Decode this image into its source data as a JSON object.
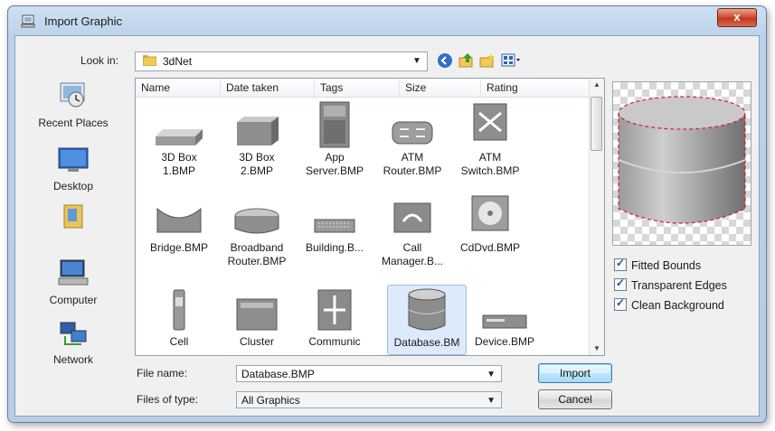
{
  "window": {
    "title": "Import Graphic",
    "close_glyph": "x"
  },
  "lookin": {
    "label": "Look in:",
    "value": "3dNet"
  },
  "places": [
    {
      "label": "Recent Places",
      "icon": "recent-places-icon"
    },
    {
      "label": "Desktop",
      "icon": "desktop-icon"
    },
    {
      "label": "",
      "icon": "user-folder-icon"
    },
    {
      "label": "Computer",
      "icon": "computer-icon"
    },
    {
      "label": "Network",
      "icon": "network-icon"
    }
  ],
  "columns": [
    "Name",
    "Date taken",
    "Tags",
    "Size",
    "Rating"
  ],
  "files": [
    {
      "line1": "3D Box",
      "line2": "1.BMP"
    },
    {
      "line1": "3D Box",
      "line2": "2.BMP"
    },
    {
      "line1": "App",
      "line2": "Server.BMP"
    },
    {
      "line1": "ATM",
      "line2": "Router.BMP"
    },
    {
      "line1": "ATM",
      "line2": "Switch.BMP"
    },
    {
      "line1": "Bridge.BMP",
      "line2": ""
    },
    {
      "line1": "Broadband",
      "line2": "Router.BMP"
    },
    {
      "line1": "Building.B...",
      "line2": ""
    },
    {
      "line1": "Call",
      "line2": "Manager.B..."
    },
    {
      "line1": "CdDvd.BMP",
      "line2": ""
    },
    {
      "line1": "Cell",
      "line2": ""
    },
    {
      "line1": "Cluster",
      "line2": ""
    },
    {
      "line1": "Communic",
      "line2": ""
    },
    {
      "line1": "Database.BM",
      "line2": ""
    },
    {
      "line1": "Device.BMP",
      "line2": ""
    }
  ],
  "options": {
    "fitted_bounds": "Fitted Bounds",
    "transparent_edges": "Transparent Edges",
    "clean_background": "Clean Background"
  },
  "filename": {
    "label": "File name:",
    "value": "Database.BMP"
  },
  "filetype": {
    "label": "Files of type:",
    "value": "All Graphics"
  },
  "buttons": {
    "import": "Import",
    "cancel": "Cancel"
  },
  "colors": {
    "selection": "#dceafc",
    "title_bar": "#bcd2ea",
    "close": "#c03a22"
  }
}
